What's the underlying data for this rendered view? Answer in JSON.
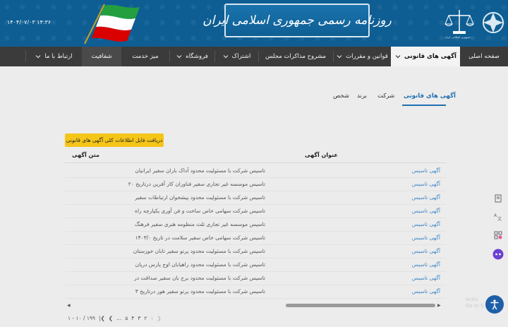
{
  "header": {
    "title": "روزنامه رسمی جمهوری اسلامی ایران",
    "datetime": "۱۴۰۴/۰۷/۰۳ ۱۴:۳۶",
    "emblem_caption": "روزنامه رسمی جمهوری اسلامی ایران"
  },
  "nav": {
    "items": [
      {
        "label": "صفحه اصلی"
      },
      {
        "label": "آگهی های قانونی"
      },
      {
        "label": "قوانین و مقررات"
      },
      {
        "label": "مشروح مذاکرات مجلس"
      },
      {
        "label": "اشتراک"
      },
      {
        "label": "فروشگاه"
      },
      {
        "label": "میز خدمت"
      },
      {
        "label": "شفافیت"
      },
      {
        "label": "ارتباط با ما"
      }
    ]
  },
  "tabs": [
    {
      "label": "آگهی های قانونی"
    },
    {
      "label": "شرکت"
    },
    {
      "label": "برند"
    },
    {
      "label": "شخص"
    }
  ],
  "download_button": "دریافت فایل اطلاعات کلی آگهی های قانونی",
  "table": {
    "col_title": "عنوان آگهی",
    "col_text": "متن آگهی",
    "rows": [
      {
        "title": "آگهی تاسیس",
        "text": "تاسیس شرکت با مسئولیت محدود آداک باران سفیر ایرانیان"
      },
      {
        "title": "آگهی تاسیس",
        "text": "تاسیس موسسه غیر تجاری سفیر فناوران کار آفرین درتاریخ ۲۰"
      },
      {
        "title": "آگهی تاسیس",
        "text": "تاسیس شرکت با مسئولیت محدود پیشخوان ارتباطات سفیر"
      },
      {
        "title": "آگهی تاسیس",
        "text": "تاسیس شرکت سهامی خاص ساخت و فن آوری یکپارچه راه"
      },
      {
        "title": "آگهی تاسیس",
        "text": "تاسیس موسسه غیر تجاری ثلث منظومه هنری سفیر فرهنگ"
      },
      {
        "title": "آگهی تاسیس",
        "text": "تاسیس شرکت سهامی خاص سفیر سلامت در تاریخ ۱۴۰۳/۰"
      },
      {
        "title": "آگهی تاسیس",
        "text": "تاسیس شرکت با مسئولیت محدود پرتو سفیر تابان خوزستان"
      },
      {
        "title": "آگهی تاسیس",
        "text": "تاسیس شرکت با مسئولیت محدود راهیابان اوج پارس دریان"
      },
      {
        "title": "آگهی تاسیس",
        "text": "تاسیس شرکت با مسئولیت محدود برج بان سفیر صداقت در"
      },
      {
        "title": "آگهی تاسیس",
        "text": "تاسیس شرکت با مسئولیت محدود پرتو سفیر هور درتاریخ ۳"
      }
    ]
  },
  "pager": {
    "summary": "۱ - ۱۰ / ۱۹۹",
    "pages": [
      "۱",
      "۲",
      "۳",
      "۴",
      "۵",
      "..."
    ]
  },
  "watermark": {
    "line1": "Activ",
    "line2": "Go to S"
  },
  "colors": {
    "banner": "#0e5e93",
    "nav": "#3b3b3b",
    "accent": "#1e6fb0",
    "download": "#f5c518"
  }
}
